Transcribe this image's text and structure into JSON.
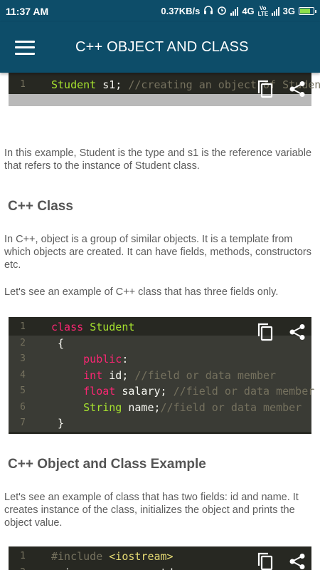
{
  "status": {
    "time": "11:37 AM",
    "speed": "0.37KB/s",
    "network1": "4G",
    "volte": "Vo LTE",
    "network2": "3G"
  },
  "appbar": {
    "title": "C++ OBJECT AND CLASS"
  },
  "code_top": {
    "line_num": "1",
    "tokens": [
      {
        "t": "Student",
        "cls": "t"
      },
      {
        "t": " s1; ",
        "cls": ""
      },
      {
        "t": "//creating an object of Student",
        "cls": "c"
      }
    ]
  },
  "para1": "In this example, Student is the type and s1 is the reference variable that refers to the instance of Student class.",
  "heading1": "C++ Class",
  "para2": "In C++, object is a group of similar objects. It is a template from which objects are created. It can have fields, methods, constructors etc.",
  "para3": "Let's see an example of C++ class that has three fields only.",
  "code_class": [
    {
      "n": "1",
      "tokens": [
        {
          "t": "class ",
          "cls": "k"
        },
        {
          "t": "Student",
          "cls": "t"
        }
      ]
    },
    {
      "n": "2",
      "tokens": [
        {
          "t": " {",
          "cls": ""
        }
      ]
    },
    {
      "n": "3",
      "tokens": [
        {
          "t": "     public",
          "cls": "k"
        },
        {
          "t": ":",
          "cls": ""
        }
      ]
    },
    {
      "n": "4",
      "tokens": [
        {
          "t": "     int",
          "cls": "k"
        },
        {
          "t": " id; ",
          "cls": ""
        },
        {
          "t": "//field or data member",
          "cls": "c"
        }
      ]
    },
    {
      "n": "5",
      "tokens": [
        {
          "t": "     float",
          "cls": "k"
        },
        {
          "t": " salary; ",
          "cls": ""
        },
        {
          "t": "//field or data member",
          "cls": "c"
        }
      ]
    },
    {
      "n": "6",
      "tokens": [
        {
          "t": "     String",
          "cls": "t"
        },
        {
          "t": " name;",
          "cls": ""
        },
        {
          "t": "//field or data member",
          "cls": "c"
        }
      ]
    },
    {
      "n": "7",
      "tokens": [
        {
          "t": " }",
          "cls": ""
        }
      ]
    }
  ],
  "heading2": "C++ Object and Class Example",
  "para4": "Let's see an example of class that has two fields: id and name. It creates instance of the class, initializes the object and prints the object value.",
  "code_example": [
    {
      "n": "1",
      "tokens": [
        {
          "t": "#include ",
          "cls": "c"
        },
        {
          "t": "<iostream>",
          "cls": "s"
        }
      ]
    },
    {
      "n": "2",
      "tokens": [
        {
          "t": "using namespace std;",
          "cls": ""
        }
      ]
    }
  ],
  "icons": {
    "copy": "copy-icon",
    "share": "share-icon",
    "menu": "hamburger-menu-icon"
  }
}
